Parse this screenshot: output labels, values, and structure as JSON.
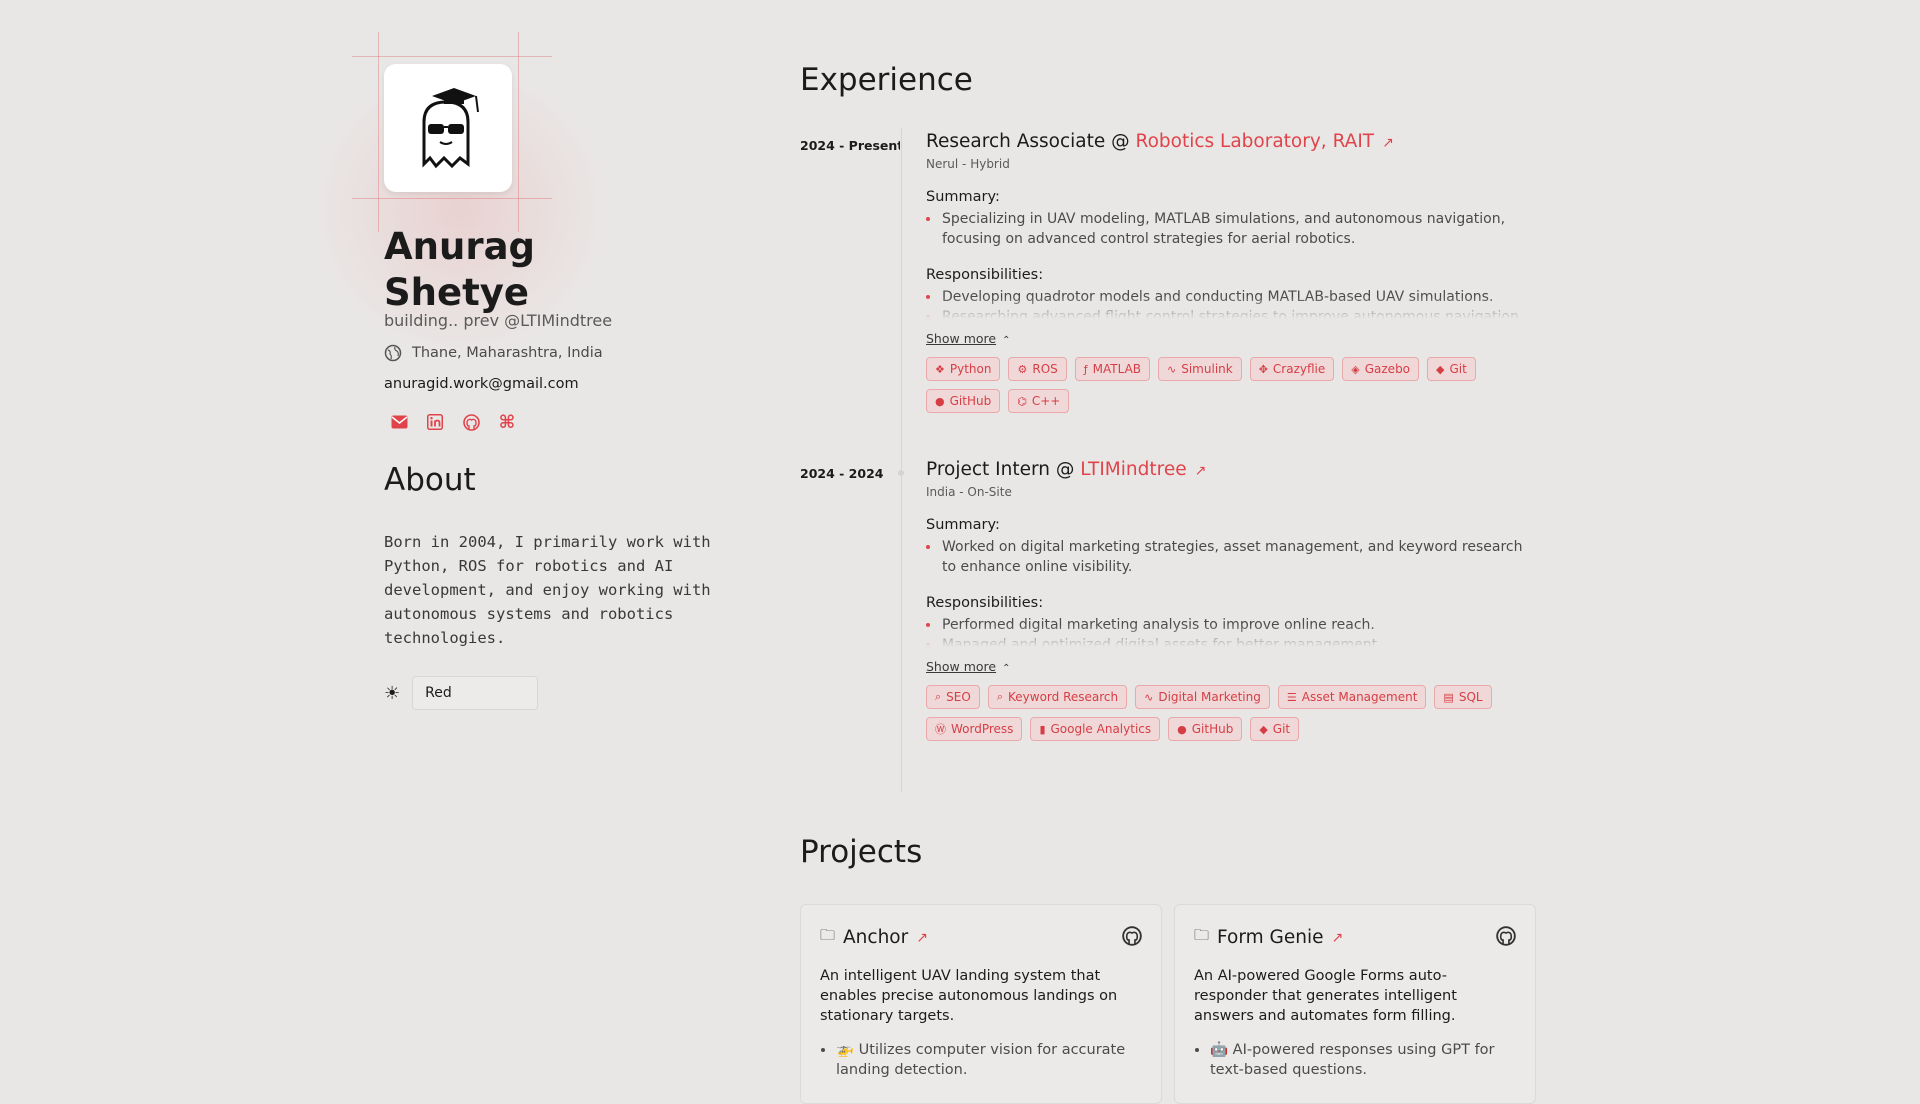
{
  "profile": {
    "first_name": "Anurag",
    "last_name": "Shetye",
    "tagline": "building.. prev @LTIMindtree",
    "location": "Thane, Maharashtra, India",
    "email": "anuragid.work@gmail.com"
  },
  "about": {
    "heading": "About",
    "text": "Born in 2004, I primarily work with Python, ROS for robotics and AI development, and enjoy working with autonomous systems and robotics technologies."
  },
  "theme": {
    "selected": "Red"
  },
  "experience": {
    "heading": "Experience",
    "jobs": [
      {
        "date": "2024 - Present",
        "role": "Research Associate @",
        "company": "Robotics Laboratory, RAIT",
        "where": "Nerul - Hybrid",
        "summary_label": "Summary:",
        "summary": "Specializing in UAV modeling, MATLAB simulations, and autonomous navigation, focusing on advanced control strategies for aerial robotics.",
        "resp_label": "Responsibilities:",
        "resp1": "Developing quadrotor models and conducting MATLAB-based UAV simulations.",
        "resp2": "Researching advanced flight control strategies to improve autonomous navigation.",
        "show_more": "Show more",
        "tags": [
          "Python",
          "ROS",
          "MATLAB",
          "Simulink",
          "Crazyflie",
          "Gazebo",
          "Git",
          "GitHub",
          "C++"
        ]
      },
      {
        "date": "2024 - 2024",
        "role": "Project Intern @",
        "company": "LTIMindtree",
        "where": "India - On-Site",
        "summary_label": "Summary:",
        "summary": "Worked on digital marketing strategies, asset management, and keyword research to enhance online visibility.",
        "resp_label": "Responsibilities:",
        "resp1": "Performed digital marketing analysis to improve online reach.",
        "resp2": "Managed and optimized digital assets for better management.",
        "show_more": "Show more",
        "tags": [
          "SEO",
          "Keyword Research",
          "Digital Marketing",
          "Asset Management",
          "SQL",
          "WordPress",
          "Google Analytics",
          "GitHub",
          "Git"
        ]
      }
    ]
  },
  "projects": {
    "heading": "Projects",
    "items": [
      {
        "title": "Anchor",
        "desc": "An intelligent UAV landing system that enables precise autonomous landings on stationary targets.",
        "point": "🚁 Utilizes computer vision for accurate landing detection."
      },
      {
        "title": "Form Genie",
        "desc": "An AI-powered Google Forms auto-responder that generates intelligent answers and automates form filling.",
        "point": "🤖 AI-powered responses using GPT for text-based questions."
      }
    ]
  },
  "colors": {
    "accent": "#e0444a",
    "background": "#e9e7e6"
  }
}
